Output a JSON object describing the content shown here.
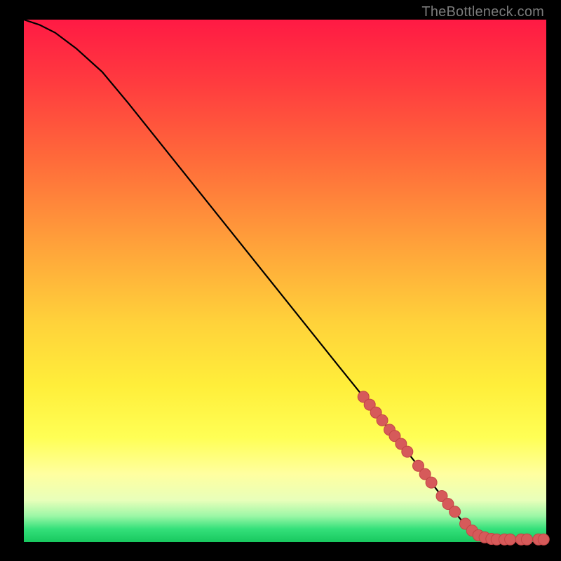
{
  "attribution": "TheBottleneck.com",
  "colors": {
    "background": "#000000",
    "curve": "#000000",
    "marker_fill": "#d65a5a",
    "marker_stroke": "#c24545",
    "attribution_text": "#7a7a7a"
  },
  "plot": {
    "x_range": [
      0,
      100
    ],
    "y_range": [
      0,
      100
    ]
  },
  "chart_data": {
    "type": "line",
    "title": "",
    "xlabel": "",
    "ylabel": "",
    "xlim": [
      0,
      100
    ],
    "ylim": [
      0,
      100
    ],
    "series": [
      {
        "name": "curve",
        "x": [
          0,
          3,
          6,
          10,
          15,
          20,
          30,
          40,
          50,
          60,
          65,
          70,
          75,
          80,
          82,
          84,
          86,
          88,
          90,
          92,
          94,
          96,
          98,
          100
        ],
        "y": [
          100,
          99,
          97.5,
          94.5,
          90,
          84,
          71.5,
          59,
          46.5,
          34,
          27.8,
          21.5,
          15.2,
          8.8,
          6.3,
          3.9,
          2.0,
          1.0,
          0.6,
          0.5,
          0.5,
          0.5,
          0.5,
          0.5
        ]
      }
    ],
    "markers": {
      "name": "highlighted-points",
      "x": [
        65.0,
        66.2,
        67.4,
        68.6,
        70.0,
        71.0,
        72.2,
        73.4,
        75.5,
        76.8,
        78.0,
        80.0,
        81.2,
        82.5,
        84.5,
        85.8,
        87.0,
        88.2,
        89.5,
        90.5,
        92.0,
        93.1,
        95.2,
        96.3,
        98.5,
        99.5
      ],
      "y": [
        27.8,
        26.3,
        24.8,
        23.3,
        21.5,
        20.3,
        18.8,
        17.3,
        14.6,
        13.0,
        11.4,
        8.8,
        7.3,
        5.8,
        3.5,
        2.2,
        1.3,
        0.9,
        0.6,
        0.5,
        0.5,
        0.5,
        0.5,
        0.5,
        0.5,
        0.5
      ]
    }
  }
}
